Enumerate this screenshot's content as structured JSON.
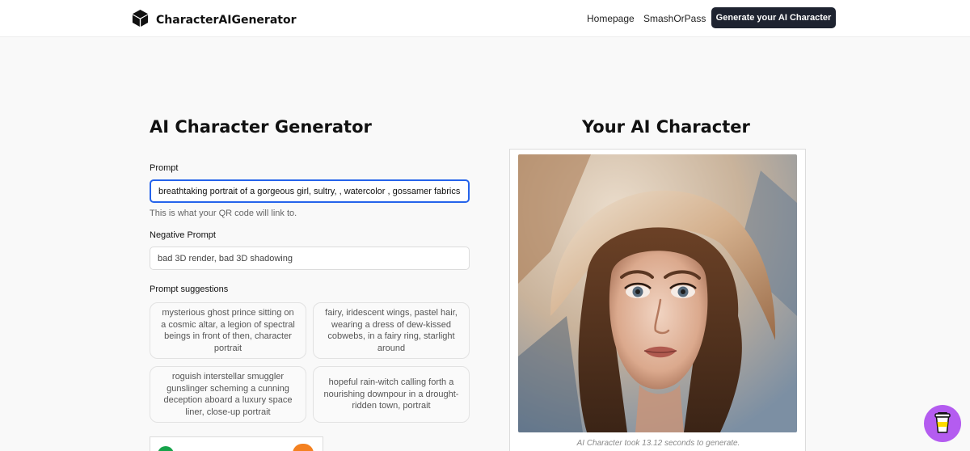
{
  "nav": {
    "brand": "CharacterAIGenerator",
    "links": [
      "Homepage",
      "SmashOrPass"
    ],
    "cta_label": "Generate your AI Character"
  },
  "form": {
    "title": "AI Character Generator",
    "prompt_label": "Prompt",
    "prompt_value": "breathtaking portrait of a gorgeous girl, sultry, , watercolor , gossamer fabrics, jade",
    "prompt_helper": "This is what your QR code will link to.",
    "negative_label": "Negative Prompt",
    "negative_placeholder": "bad 3D render, bad 3D shadowing",
    "suggestions_label": "Prompt suggestions",
    "suggestions": [
      "mysterious ghost prince sitting on a cosmic altar, a legion of spectral beings in front of then, character portrait",
      "fairy, iridescent wings, pastel hair, wearing a dress of dew-kissed cobwebs, in a fairy ring, starlight around",
      "roguish interstellar smuggler gunslinger scheming a cunning deception aboard a luxury space liner, close-up portrait",
      "hopeful rain-witch calling forth a nourishing downpour in a drought-ridden town, portrait"
    ]
  },
  "result": {
    "title": "Your AI Character",
    "caption": "AI Character took 13.12 seconds to generate."
  },
  "icons": {
    "brand": "cube-icon",
    "fab": "coffee-cup-icon"
  },
  "colors": {
    "cta_bg": "#1e2330",
    "focus_border": "#2563eb",
    "fab_bg": "#b45cf0",
    "page_bg": "#f9f9f9"
  }
}
